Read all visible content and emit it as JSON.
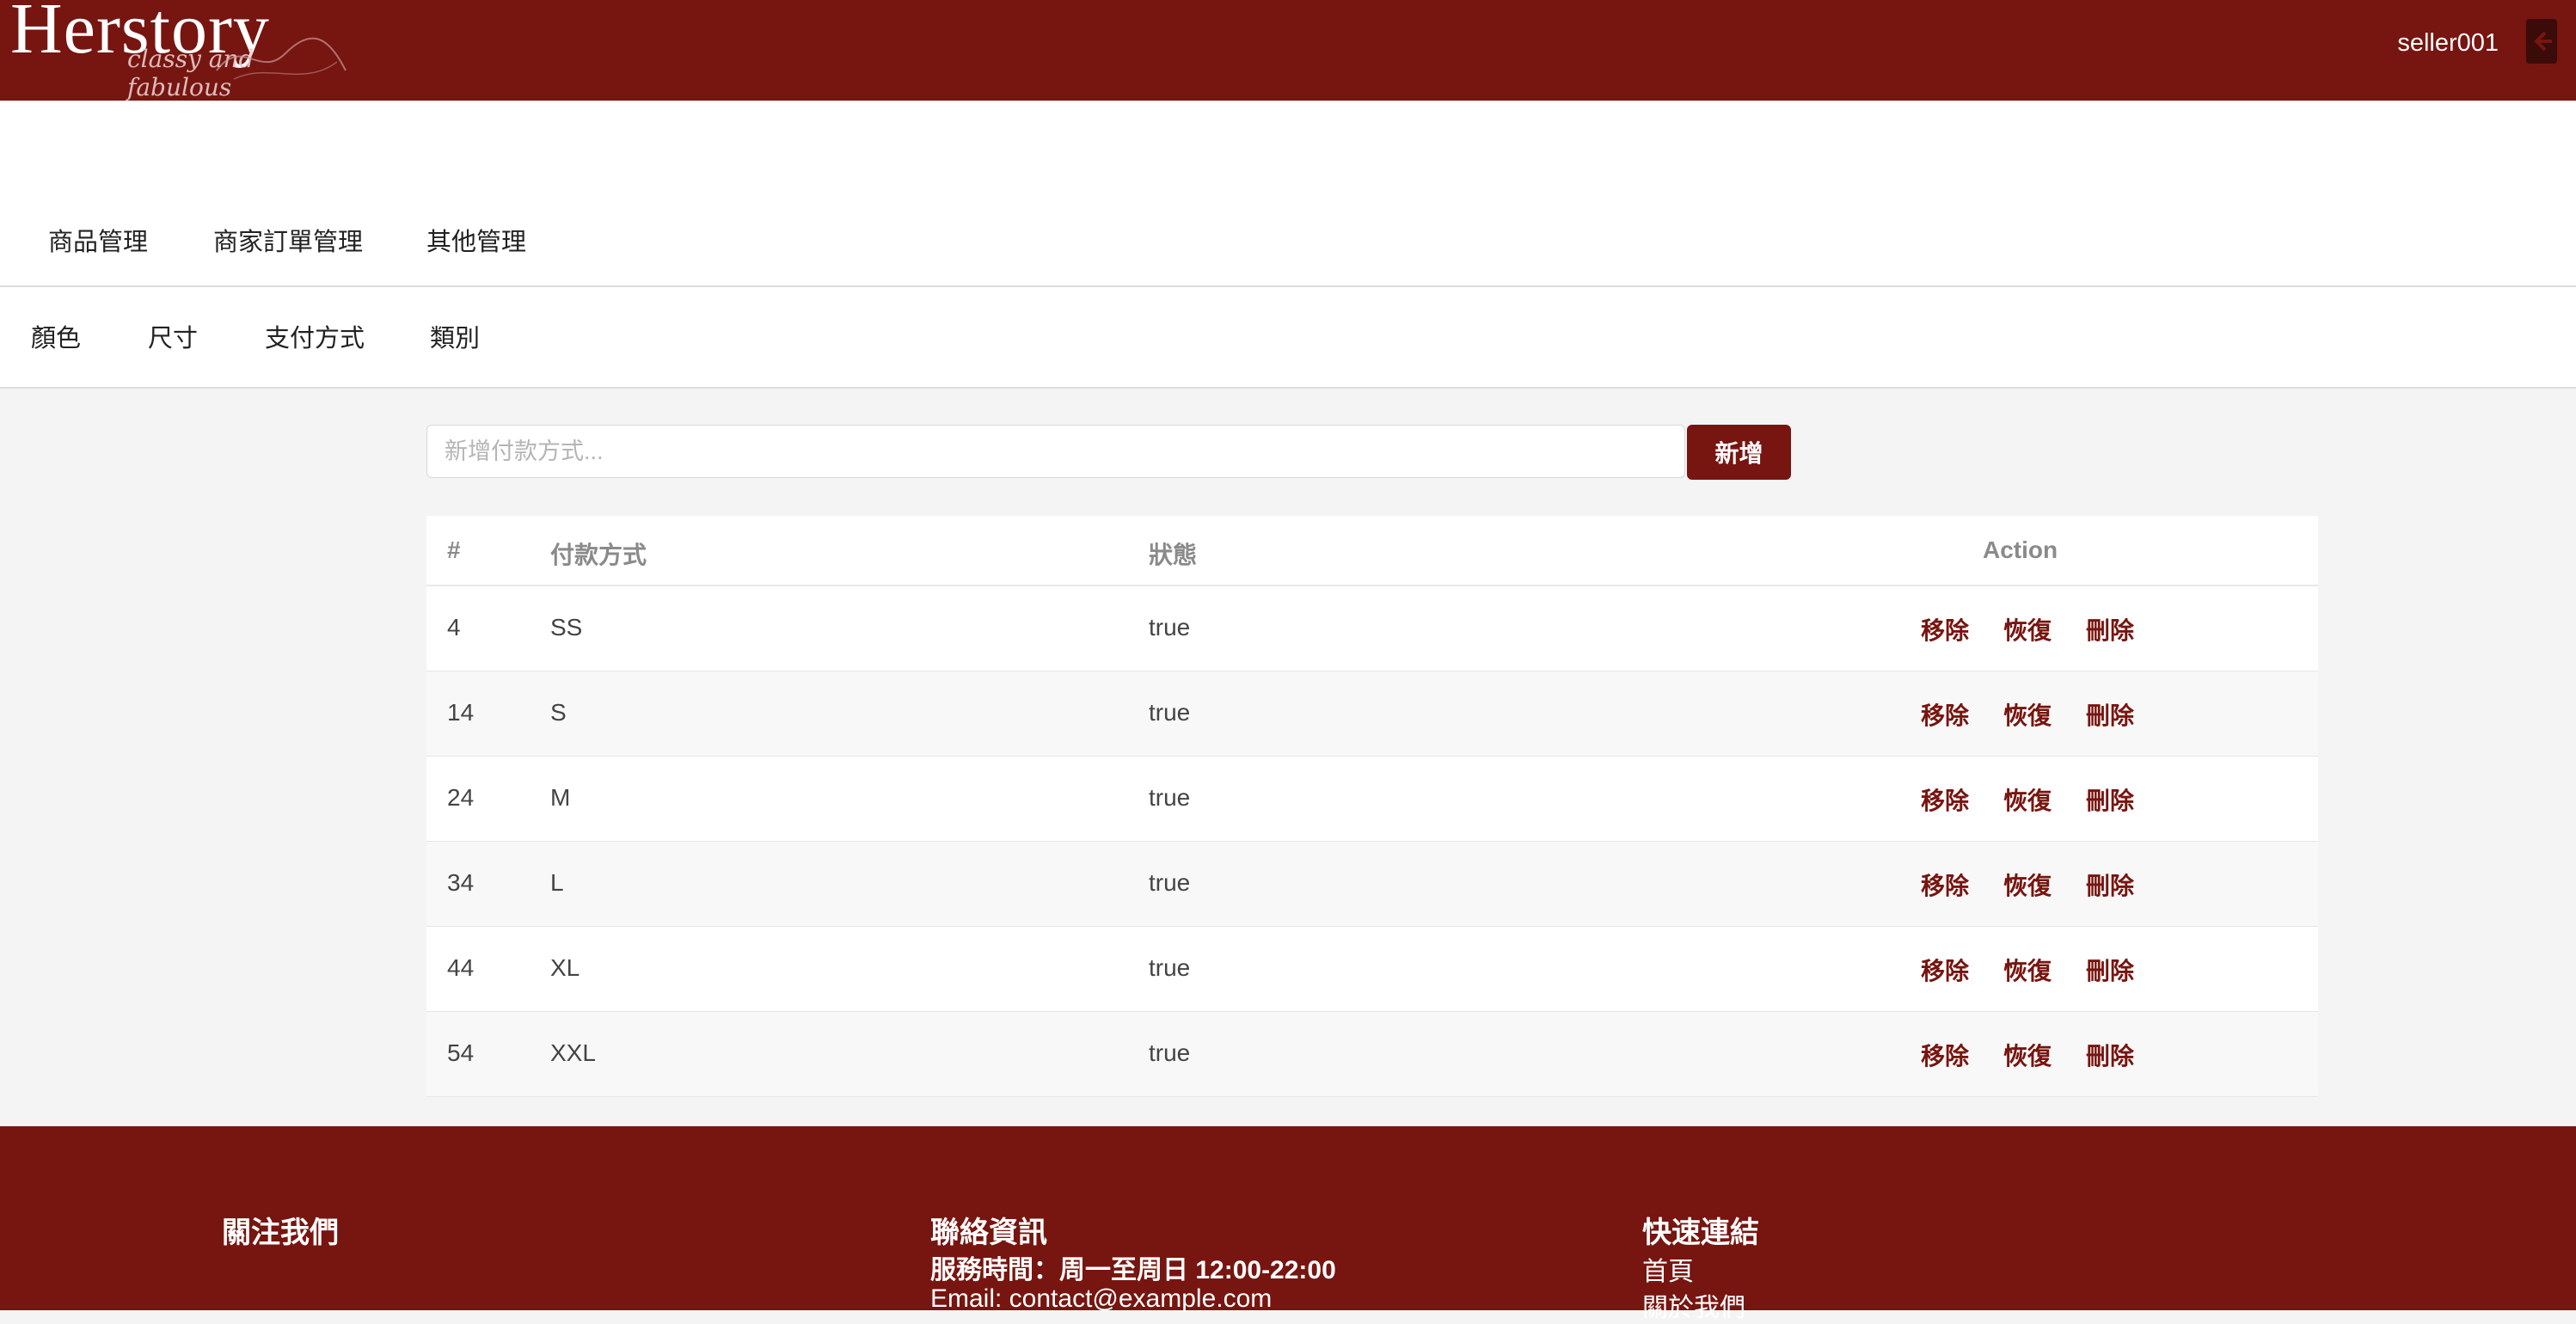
{
  "header": {
    "logo": "Herstory",
    "logo_tagline": "classy and fabulous",
    "username": "seller001",
    "logout_icon": "logout-icon"
  },
  "main_nav": [
    "商品管理",
    "商家訂單管理",
    "其他管理"
  ],
  "sub_nav": [
    "顏色",
    "尺寸",
    "支付方式",
    "類別"
  ],
  "form": {
    "placeholder": "新增付款方式...",
    "value": "",
    "add_label": "新增"
  },
  "table": {
    "headers": {
      "id": "#",
      "name": "付款方式",
      "status": "狀態",
      "action": "Action"
    },
    "actions": {
      "remove": "移除",
      "restore": "恢復",
      "delete": "刪除"
    },
    "rows": [
      {
        "id": "4",
        "name": "SS",
        "status": "true"
      },
      {
        "id": "14",
        "name": "S",
        "status": "true"
      },
      {
        "id": "24",
        "name": "M",
        "status": "true"
      },
      {
        "id": "34",
        "name": "L",
        "status": "true"
      },
      {
        "id": "44",
        "name": "XL",
        "status": "true"
      },
      {
        "id": "54",
        "name": "XXL",
        "status": "true"
      }
    ]
  },
  "footer": {
    "follow": {
      "title": "關注我們"
    },
    "contact": {
      "title": "聯絡資訊",
      "hours": "服務時間：周一至周日 12:00-22:00",
      "email": "Email: contact@example.com"
    },
    "links": {
      "title": "快速連結",
      "items": [
        "首頁",
        "關於我們"
      ]
    }
  },
  "colors": {
    "brand": "#771510",
    "page_bg": "#f4f4f4"
  }
}
